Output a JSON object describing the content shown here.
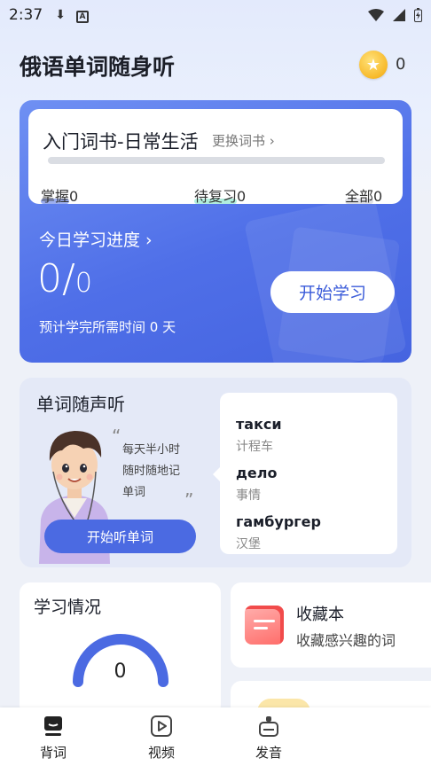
{
  "status_bar": {
    "time": "2:37"
  },
  "header": {
    "title": "俄语单词随身听",
    "coins": "0"
  },
  "book": {
    "title": "入门词书-日常生活",
    "change_label": "更换词书 ›",
    "progress": 0,
    "stats": {
      "mastered_label": "掌握",
      "mastered_value": "0",
      "review_label": "待复习",
      "review_value": "0",
      "all_label": "全部",
      "all_value": "0"
    }
  },
  "today": {
    "title": "今日学习进度 ›",
    "done": "0",
    "slash": "/",
    "total": "0",
    "start_label": "开始学习",
    "estimate_prefix": "预计学完所需时间",
    "estimate_value": "0",
    "estimate_unit": "天"
  },
  "listen": {
    "title": "单词随声听",
    "slogan_1": "每天半小时",
    "slogan_2": "随时随地记",
    "slogan_3": "单词",
    "button_label": "开始听单词",
    "words": [
      {
        "ru": "такси",
        "zh": "计程车"
      },
      {
        "ru": "дело",
        "zh": "事情"
      },
      {
        "ru": "гамбургер",
        "zh": "汉堡"
      }
    ]
  },
  "study": {
    "title": "学习情况",
    "value": "0"
  },
  "favorites": {
    "title": "收藏本",
    "subtitle": "收藏感兴趣的词"
  },
  "nav": {
    "items": [
      {
        "label": "背词"
      },
      {
        "label": "视频"
      },
      {
        "label": "发音"
      }
    ]
  },
  "colors": {
    "accent": "#4b6ae2",
    "card_blue": "#5577ea",
    "fav_red": "#ff6d6a"
  }
}
